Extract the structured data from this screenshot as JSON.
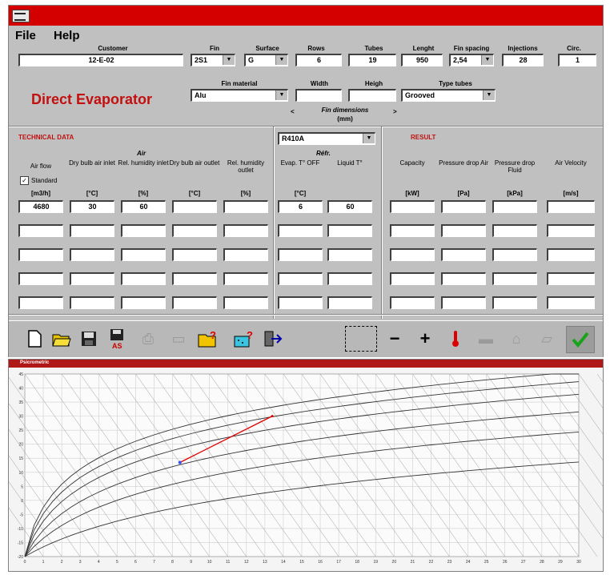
{
  "menu": {
    "file": "File",
    "help": "Help"
  },
  "header": {
    "customer_label": "Customer",
    "customer": "12-E-02",
    "fin_label": "Fin",
    "fin": "2S1",
    "surface_label": "Surface",
    "surface": "G",
    "rows_label": "Rows",
    "rows": "6",
    "tubes_label": "Tubes",
    "tubes": "19",
    "length_label": "Lenght",
    "length": "950",
    "fin_spacing_label": "Fin spacing",
    "fin_spacing": "2,54",
    "injections_label": "Injections",
    "injections": "28",
    "circ_label": "Circ.",
    "circ": "1",
    "brand": "Direct Evaporator",
    "fin_material_label": "Fin material",
    "fin_material": "Alu",
    "width_label": "Width",
    "height_label": "Heigh",
    "type_tubes_label": "Type tubes",
    "type_tubes": "Grooved",
    "fin_dim_label": "Fin dimensions",
    "fin_dim_unit": "(mm)"
  },
  "technical": {
    "title": "TECHNICAL DATA",
    "refrigerant": "R410A",
    "result_title": "RESULT",
    "air_group": "Air",
    "refr_group": "Réfr.",
    "standard_label": "Standard",
    "cols": [
      {
        "h": "Air flow",
        "u": "[m3/h]"
      },
      {
        "h": "Dry bulb air inlet",
        "u": "[°C]"
      },
      {
        "h": "Rel. humidity inlet",
        "u": "[%]"
      },
      {
        "h": "Dry bulb air outlet",
        "u": "[°C]"
      },
      {
        "h": "Rel. humidity outlet",
        "u": "[%]"
      },
      {
        "h": "Evap. T° OFF",
        "u": "[°C]"
      },
      {
        "h": "Liquid T°",
        "u": ""
      },
      {
        "h": "Capacity",
        "u": "[kW]"
      },
      {
        "h": "Pressure drop Air",
        "u": "[Pa]"
      },
      {
        "h": "Pressure drop Fluid",
        "u": "[kPa]"
      },
      {
        "h": "Air Velocity",
        "u": "[m/s]"
      }
    ],
    "row1": [
      "4680",
      "30",
      "60",
      "",
      "",
      "6",
      "60",
      "",
      "",
      "",
      ""
    ]
  },
  "chart_window": {
    "title": "Psicrometric"
  },
  "colors": {
    "title": "#d40000",
    "brand": "#c21010",
    "ok": "#1aa31a"
  },
  "chart_data": {
    "type": "line",
    "title": "",
    "xlabel": "",
    "ylabel": "",
    "x_ticks": [
      "0",
      "1",
      "2",
      "3",
      "4",
      "5",
      "6",
      "7",
      "8",
      "9",
      "10",
      "11",
      "12",
      "13",
      "14",
      "15",
      "16",
      "17",
      "18",
      "19",
      "20",
      "21",
      "22",
      "23",
      "24",
      "25",
      "26",
      "27",
      "28",
      "29",
      "30"
    ],
    "y_ticks": [
      "-20",
      "-15",
      "-10",
      "-5",
      "0",
      "5",
      "10",
      "15",
      "20",
      "25",
      "30",
      "35",
      "40",
      "45"
    ],
    "xlim": [
      0,
      30
    ],
    "ylim": [
      -20,
      45
    ],
    "series": [
      {
        "values": [
          [
            8.4,
            13.5
          ],
          [
            13.4,
            30
          ]
        ]
      }
    ]
  }
}
